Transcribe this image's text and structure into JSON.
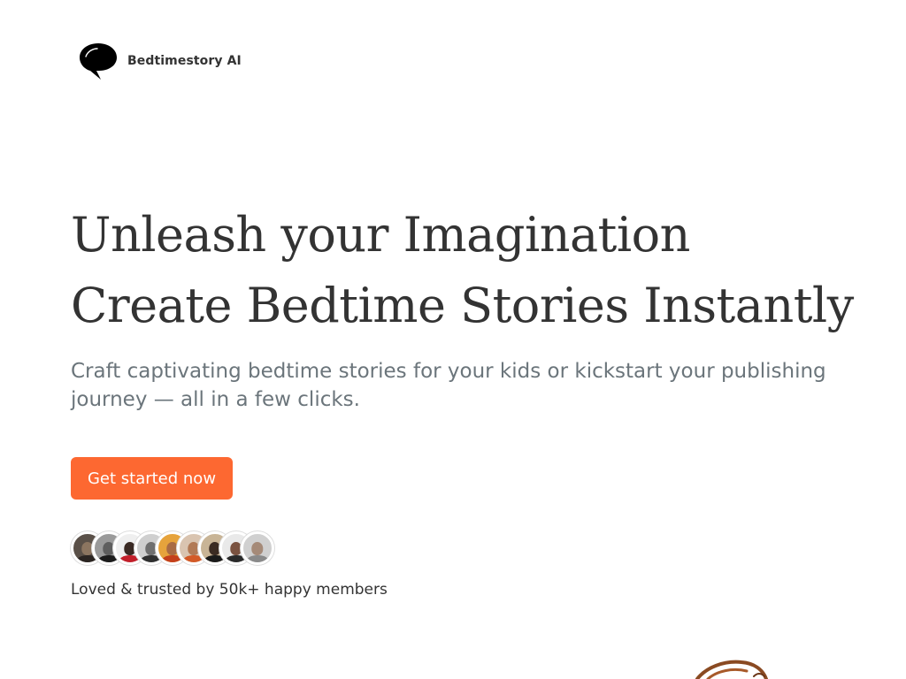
{
  "header": {
    "brand_name": "Bedtimestory AI",
    "logo_icon": "speech-bubble-icon"
  },
  "hero": {
    "headline_line1": "Unleash your Imagination",
    "headline_line2": "Create Bedtime Stories Instantly",
    "subtitle": "Craft captivating bedtime stories for your kids or kickstart your publishing journey — all in a few clicks."
  },
  "cta": {
    "label": "Get started now",
    "color": "#fd6831"
  },
  "social_proof": {
    "avatar_count": 9,
    "text": "Loved & trusted by 50k+ happy members"
  },
  "colors": {
    "headline": "#333333",
    "subtitle": "#6b757b",
    "accent": "#fd6831",
    "background": "#ffffff"
  }
}
